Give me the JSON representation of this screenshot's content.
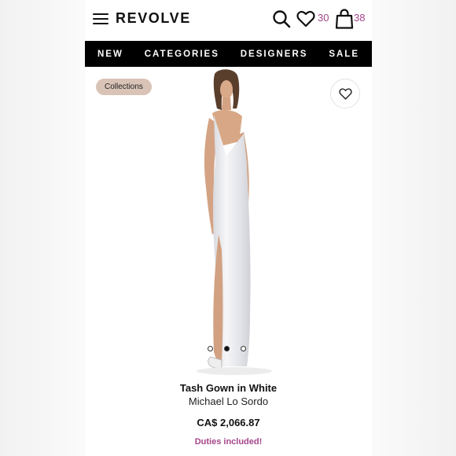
{
  "header": {
    "brand": "REVOLVE",
    "wishlist_count": "30",
    "bag_count": "38"
  },
  "nav": {
    "items": [
      "NEW",
      "CATEGORIES",
      "DESIGNERS",
      "SALE"
    ]
  },
  "product": {
    "chip_label": "Collections",
    "name": "Tash Gown in White",
    "brand": "Michael Lo Sordo",
    "price": "CA$ 2,066.87",
    "duties_note": "Duties included!",
    "carousel": {
      "count": 3,
      "active_index": 1
    }
  },
  "colors": {
    "accent": "#a4468b",
    "nav_bg": "#000000",
    "chip_bg": "#d9c3b7"
  },
  "icons": [
    "menu-icon",
    "search-icon",
    "heart-icon",
    "bag-icon",
    "heart-outline-icon"
  ]
}
